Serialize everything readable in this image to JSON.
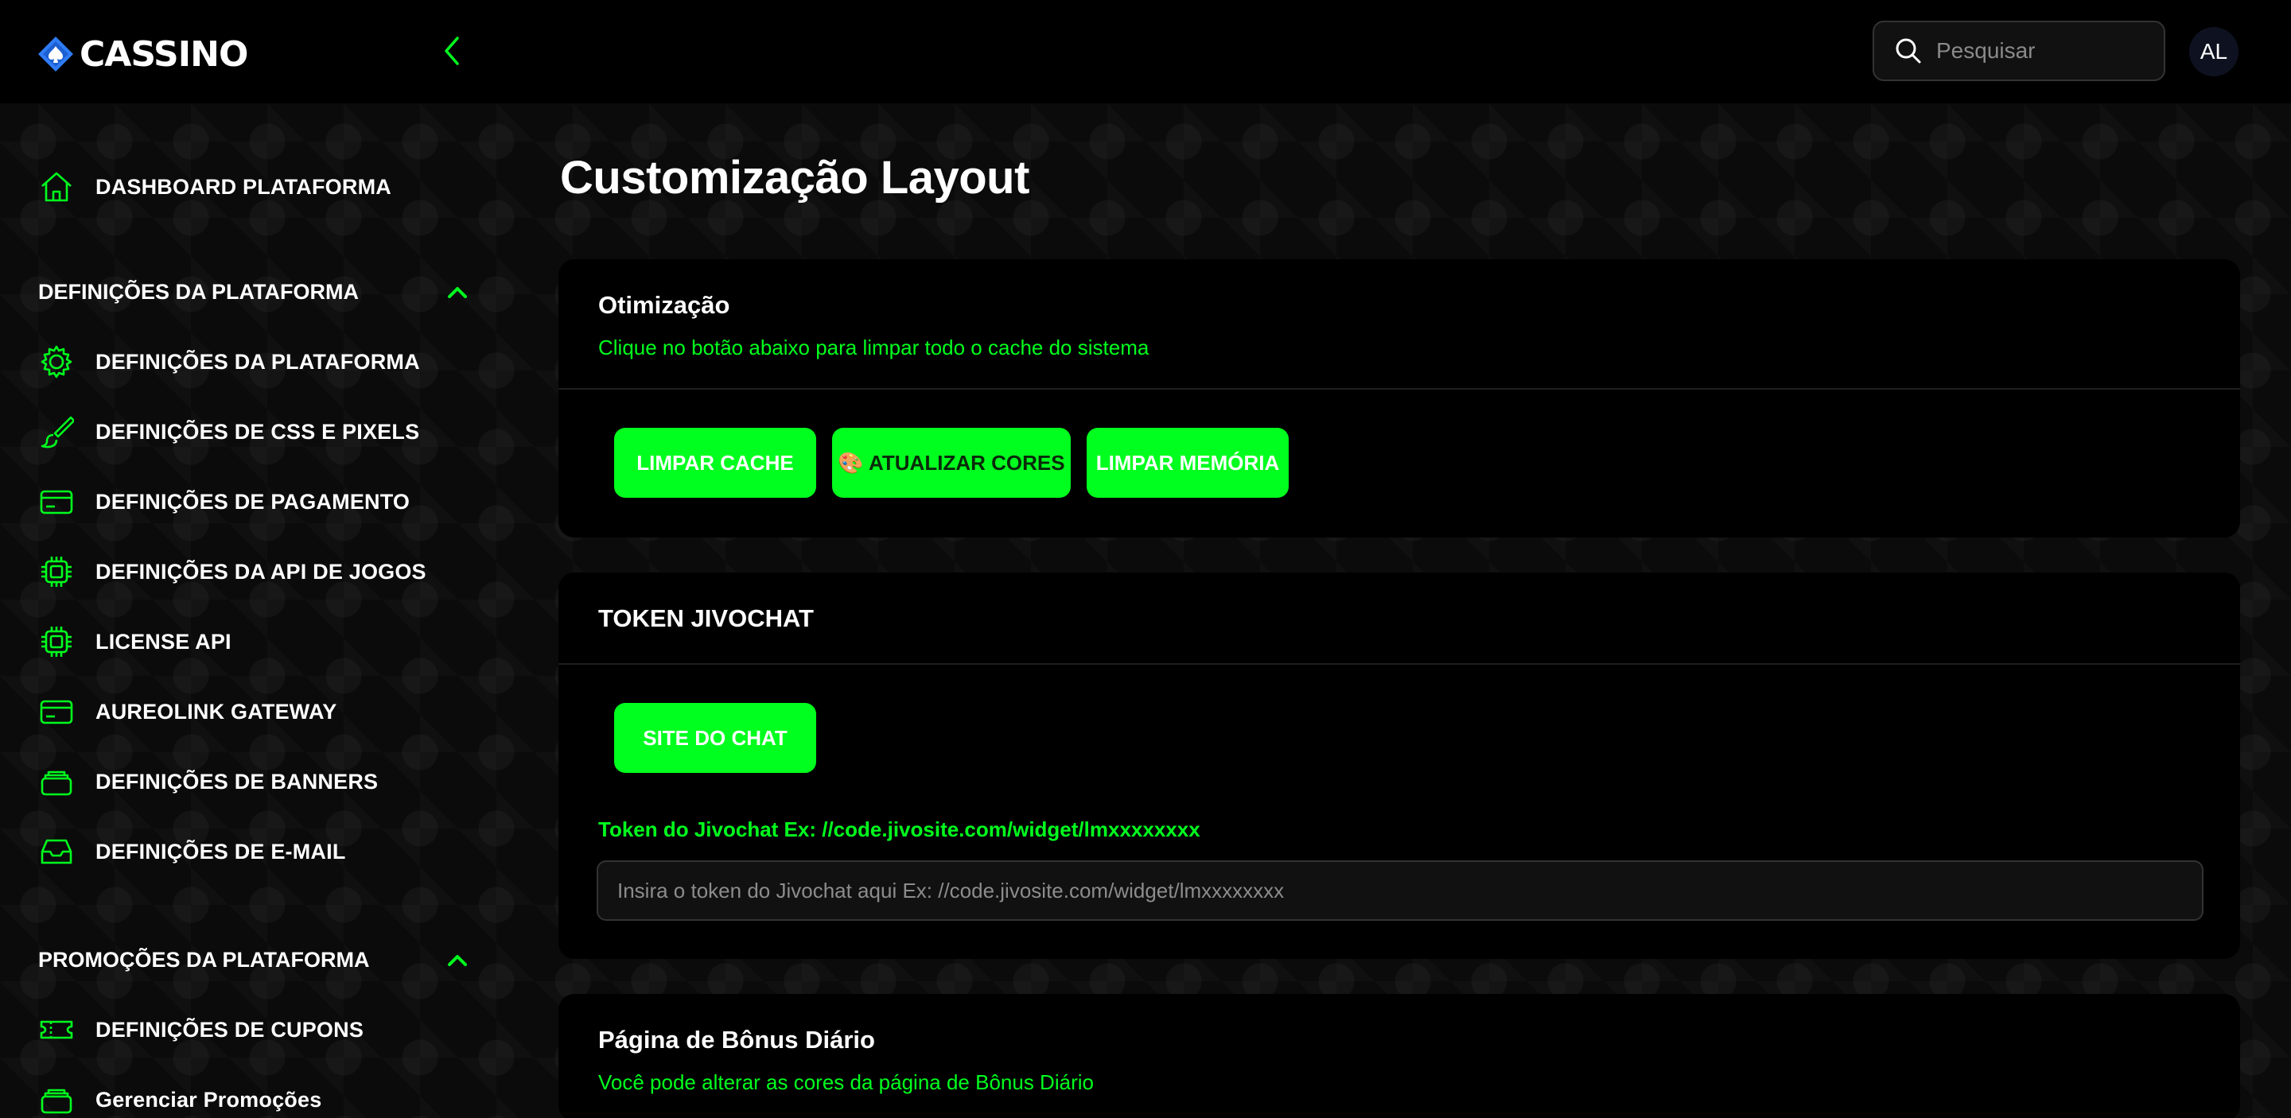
{
  "brand": {
    "name": "CASSINO",
    "accent": "#00ff1e"
  },
  "header": {
    "search_placeholder": "Pesquisar",
    "avatar_initials": "AL"
  },
  "sidebar": {
    "dashboard": {
      "label": "DASHBOARD PLATAFORMA",
      "icon": "home-icon"
    },
    "sections": [
      {
        "title": "DEFINIÇÕES DA PLATAFORMA",
        "expanded": true,
        "items": [
          {
            "label": "DEFINIÇÕES DA PLATAFORMA",
            "icon": "gear-icon"
          },
          {
            "label": "DEFINIÇÕES DE CSS E PIXELS",
            "icon": "brush-icon"
          },
          {
            "label": "DEFINIÇÕES DE PAGAMENTO",
            "icon": "credit-card-icon"
          },
          {
            "label": "DEFINIÇÕES DA API DE JOGOS",
            "icon": "cpu-chip-icon"
          },
          {
            "label": "LICENSE API",
            "icon": "cpu-chip-icon"
          },
          {
            "label": "AUREOLINK GATEWAY",
            "icon": "credit-card-icon"
          },
          {
            "label": "DEFINIÇÕES DE BANNERS",
            "icon": "stack-icon"
          },
          {
            "label": "DEFINIÇÕES DE E-MAIL",
            "icon": "inbox-icon"
          }
        ]
      },
      {
        "title": "PROMOÇÕES DA PLATAFORMA",
        "expanded": true,
        "items": [
          {
            "label": "DEFINIÇÕES DE CUPONS",
            "icon": "ticket-icon"
          },
          {
            "label": "Gerenciar Promoções",
            "icon": "stack-icon"
          }
        ]
      }
    ]
  },
  "main": {
    "title": "Customização Layout",
    "optimization": {
      "title": "Otimização",
      "subtitle": "Clique no botão abaixo para limpar todo o cache do sistema",
      "buttons": [
        "LIMPAR CACHE",
        "🎨 ATUALIZAR CORES",
        "LIMPAR MEMÓRIA"
      ]
    },
    "jivochat": {
      "title": "TOKEN JIVOCHAT",
      "button": "SITE DO CHAT",
      "field_label": "Token do Jivochat Ex: //code.jivosite.com/widget/lmxxxxxxxx",
      "field_placeholder": "Insira o token do Jivochat aqui Ex: //code.jivosite.com/widget/lmxxxxxxxx",
      "field_value": ""
    },
    "daily_bonus": {
      "title": "Página de Bônus Diário",
      "subtitle": "Você pode alterar as cores da página de Bônus Diário"
    }
  }
}
